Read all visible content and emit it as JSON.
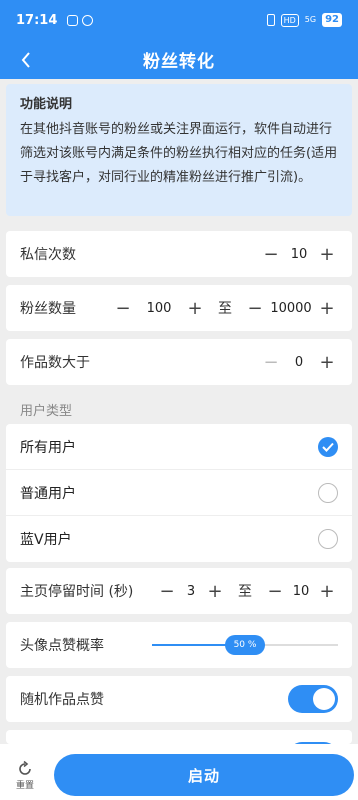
{
  "status": {
    "time": "17:14",
    "hd": "HD",
    "signal": "5G",
    "battery": "92"
  },
  "nav": {
    "title": "粉丝转化"
  },
  "info": {
    "heading": "功能说明",
    "body": "在其他抖音账号的粉丝或关注界面运行，软件自动进行筛选对该账号内满足条件的粉丝执行相对应的任务(适用于寻找客户，对同行业的精准粉丝进行推广引流)。"
  },
  "settings": {
    "dm_label": "私信次数",
    "dm_value": "10",
    "fans_label": "粉丝数量",
    "fans_min": "100",
    "fans_to": "至",
    "fans_max": "10000",
    "works_label": "作品数大于",
    "works_value": "0"
  },
  "user_type": {
    "label": "用户类型",
    "options": [
      {
        "label": "所有用户",
        "selected": true
      },
      {
        "label": "普通用户",
        "selected": false
      },
      {
        "label": "蓝V用户",
        "selected": false
      }
    ]
  },
  "stay": {
    "label": "主页停留时间 (秒)",
    "min": "3",
    "to": "至",
    "max": "10"
  },
  "avatar_like": {
    "label": "头像点赞概率",
    "value_text": "50 %",
    "value": 0.5
  },
  "random_like": {
    "label": "随机作品点赞",
    "on": true
  },
  "bottom": {
    "reset_label": "重置",
    "start_label": "启动"
  },
  "colors": {
    "accent": "#2f8ef4",
    "info_bg": "#dcebfc"
  }
}
